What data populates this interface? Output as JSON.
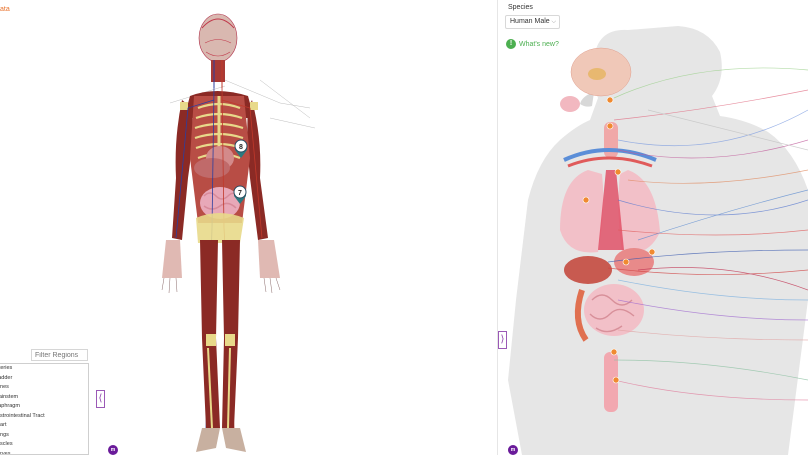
{
  "left_panel": {
    "corner_link": "ata",
    "filter_placeholder": "Filter Regions",
    "regions": [
      "rteries",
      "ladder",
      "ones",
      "rainstem",
      "iaphragm",
      "astrointestinal Tract",
      "eart",
      "ungs",
      "uscles",
      "erves"
    ],
    "markers": [
      "8",
      "7"
    ],
    "collapse_glyph": "⟨",
    "logo_text": "m"
  },
  "right_panel": {
    "species_label": "Species",
    "species_value": "Human Male",
    "whats_new_icon": "!",
    "whats_new_label": "What's new?",
    "expand_glyph": "⟩",
    "logo_text": "m"
  },
  "colors": {
    "accent_purple": "#8e44ad",
    "link_green": "#4caf50",
    "corner_orange": "#e8712b",
    "muscle": "#8b2a25",
    "silhouette": "#e6e6e6"
  }
}
